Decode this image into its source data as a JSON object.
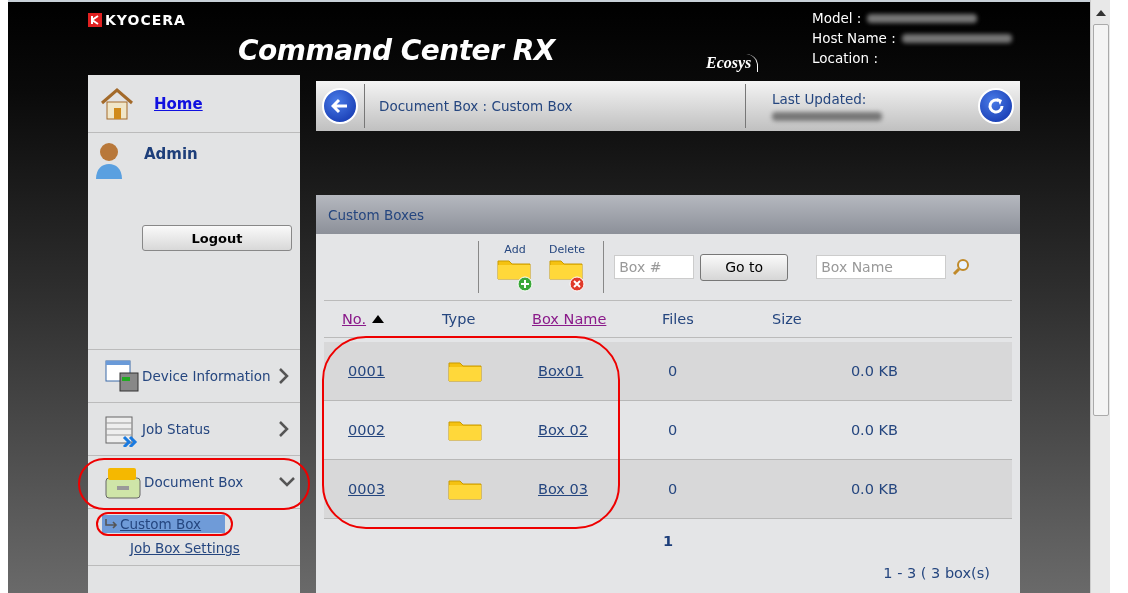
{
  "header": {
    "brand": "KYOCERA",
    "title": "Command Center RX",
    "sub_logo": "Ecosys",
    "info": [
      {
        "label": "Model :",
        "redacted": true
      },
      {
        "label": "Host Name :",
        "redacted": true
      },
      {
        "label": "Location :",
        "redacted": false
      }
    ]
  },
  "sidebar": {
    "home": "Home",
    "user": "Admin",
    "logout": "Logout",
    "items": [
      {
        "kind": "device",
        "label": "Device Information",
        "expanded": false,
        "circled": false
      },
      {
        "kind": "job",
        "label": "Job Status",
        "expanded": false,
        "circled": false
      },
      {
        "kind": "docbox",
        "label": "Document Box",
        "expanded": true,
        "circled": true,
        "children": [
          {
            "label": "Custom Box",
            "selected": true,
            "circled": true
          },
          {
            "label": "Job Box Settings",
            "selected": false,
            "circled": false
          }
        ]
      }
    ]
  },
  "breadcrumb": {
    "path": "Document Box : Custom Box",
    "last_updated_label": "Last Updated:",
    "last_updated_redacted": true
  },
  "panel": {
    "title": "Custom Boxes",
    "add": "Add",
    "delete": "Delete",
    "box_number": {
      "placeholder": "Box #"
    },
    "goto": "Go to",
    "box_name": {
      "placeholder": "Box Name"
    },
    "columns": [
      {
        "label": "No.",
        "link": true,
        "sorted": true
      },
      {
        "label": "Type",
        "link": false,
        "sorted": false
      },
      {
        "label": "Box Name",
        "link": true,
        "sorted": false
      },
      {
        "label": "Files",
        "link": false,
        "sorted": false
      },
      {
        "label": "Size",
        "link": false,
        "sorted": false
      }
    ],
    "rows_circled": true,
    "rows": [
      {
        "no": "0001",
        "name": "Box01",
        "files": "0",
        "size": "0.0 KB"
      },
      {
        "no": "0002",
        "name": "Box 02",
        "files": "0",
        "size": "0.0 KB"
      },
      {
        "no": "0003",
        "name": "Box 03",
        "files": "0",
        "size": "0.0 KB"
      }
    ],
    "page": "1",
    "count": "1 - 3 ( 3 box(s)"
  }
}
